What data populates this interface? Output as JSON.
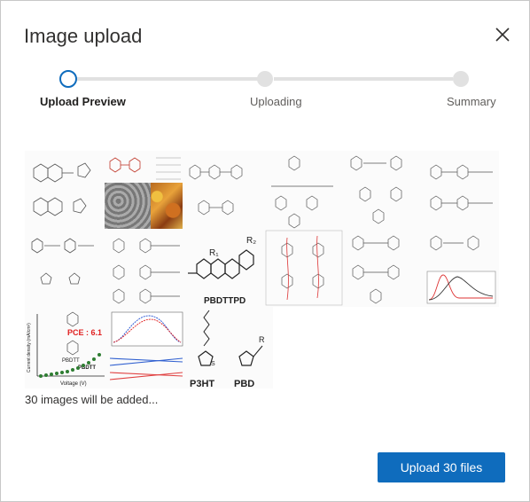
{
  "dialog": {
    "title": "Image upload",
    "close_icon": "close-icon"
  },
  "stepper": {
    "steps": [
      {
        "label": "Upload Preview",
        "state": "active"
      },
      {
        "label": "Uploading",
        "state": "pending"
      },
      {
        "label": "Summary",
        "state": "pending"
      }
    ],
    "accent": "#0f6cbd",
    "track_color": "#e1e1e1"
  },
  "thumbnails": {
    "text": {
      "pbdttpd": "PBDTTPD",
      "p3ht": "P3HT",
      "pbd": "PBD",
      "pce": "PCE : 6.1",
      "pbdtt": "PBDTT",
      "pbdtt2": "PBDTT",
      "ylabel": "Current density (mA/cm²)",
      "xlabel": "Voltage (V)",
      "r2": "R₂",
      "r1": "R₁",
      "r_big": "R"
    }
  },
  "status": {
    "text": "30 images will be added..."
  },
  "actions": {
    "upload_label": "Upload 30 files",
    "upload_color": "#0f6cbd"
  }
}
